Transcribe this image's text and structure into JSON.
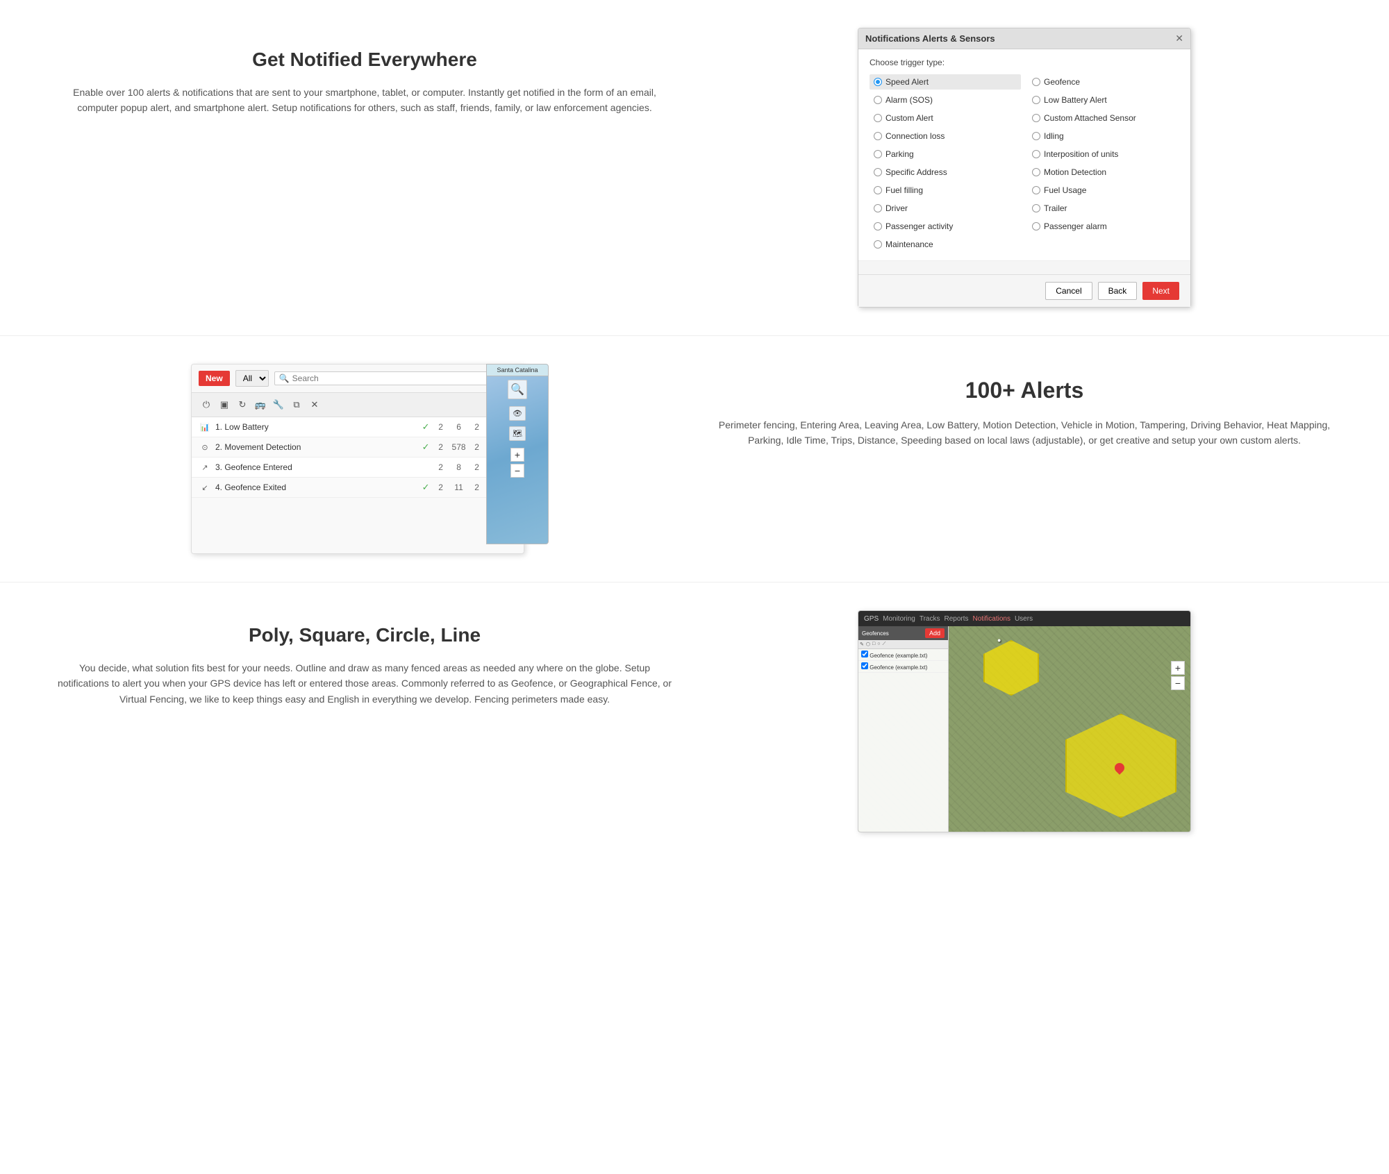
{
  "section1": {
    "title": "Get Notified Everywhere",
    "description": "Enable over 100 alerts & notifications that are sent to your smartphone, tablet, or computer. Instantly get notified in the form of an email, computer popup alert, and smartphone alert. Setup notifications for others, such as staff, friends, family, or law enforcement agencies.",
    "dialog": {
      "title": "Notifications Alerts & Sensors",
      "label": "Choose trigger type:",
      "options_col1": [
        {
          "label": "Speed Alert",
          "selected": true
        },
        {
          "label": "Alarm (SOS)",
          "selected": false
        },
        {
          "label": "Custom Alert",
          "selected": false
        },
        {
          "label": "Connection loss",
          "selected": false
        },
        {
          "label": "Parking",
          "selected": false
        },
        {
          "label": "Specific Address",
          "selected": false
        },
        {
          "label": "Fuel filling",
          "selected": false
        },
        {
          "label": "Driver",
          "selected": false
        },
        {
          "label": "Passenger activity",
          "selected": false
        },
        {
          "label": "Maintenance",
          "selected": false
        }
      ],
      "options_col2": [
        {
          "label": "Geofence",
          "selected": false
        },
        {
          "label": "Low Battery Alert",
          "selected": false
        },
        {
          "label": "Custom Attached Sensor",
          "selected": false
        },
        {
          "label": "Idling",
          "selected": false
        },
        {
          "label": "Interposition of units",
          "selected": false
        },
        {
          "label": "Motion Detection",
          "selected": false
        },
        {
          "label": "Fuel Usage",
          "selected": false
        },
        {
          "label": "Trailer",
          "selected": false
        },
        {
          "label": "Passenger alarm",
          "selected": false
        }
      ],
      "btn_cancel": "Cancel",
      "btn_back": "Back",
      "btn_next": "Next"
    }
  },
  "section2": {
    "title": "100+ Alerts",
    "description": "Perimeter fencing, Entering Area, Leaving Area, Low Battery, Motion Detection, Vehicle in Motion, Tampering, Driving Behavior, Heat Mapping, Parking, Idle Time, Trips, Distance, Speeding based on local laws (adjustable), or get creative and setup your own custom alerts.",
    "toolbar": {
      "btn_new": "New",
      "select_placeholder": "All",
      "search_placeholder": "Search"
    },
    "rows": [
      {
        "icon": "chart",
        "name": "1. Low Battery",
        "checked": true,
        "col1": "2",
        "col2": "6",
        "col3": "2"
      },
      {
        "icon": "circle",
        "name": "2. Movement Detection",
        "checked": true,
        "col1": "2",
        "col2": "578",
        "col3": "2"
      },
      {
        "icon": "fence",
        "name": "3. Geofence Entered",
        "checked": false,
        "col1": "2",
        "col2": "8",
        "col3": "2"
      },
      {
        "icon": "fence2",
        "name": "4. Geofence Exited",
        "checked": true,
        "col1": "2",
        "col2": "11",
        "col3": "2"
      }
    ],
    "map_label": "Santa Catalina d."
  },
  "section3": {
    "title": "Poly, Square, Circle, Line",
    "description": "You decide, what solution fits best for your needs. Outline and draw as many fenced areas as needed any where on the globe. Setup notifications to alert you when your GPS device has left or entered those areas. Commonly referred to as Geofence, or Geographical Fence, or Virtual Fencing, we like to keep things easy and English in everything we develop. Fencing perimeters made easy.",
    "geo_mockup": {
      "titlebar": "GPS Tracks | Monitoring | Tracks | Reports | Notifications | Users",
      "btn_add": "Add",
      "sidebar_header": "Geofences",
      "sidebar_rows": [
        "Geofence (example.txt)",
        "Geofence (example.txt)"
      ],
      "map_area": "satellite map view"
    }
  }
}
